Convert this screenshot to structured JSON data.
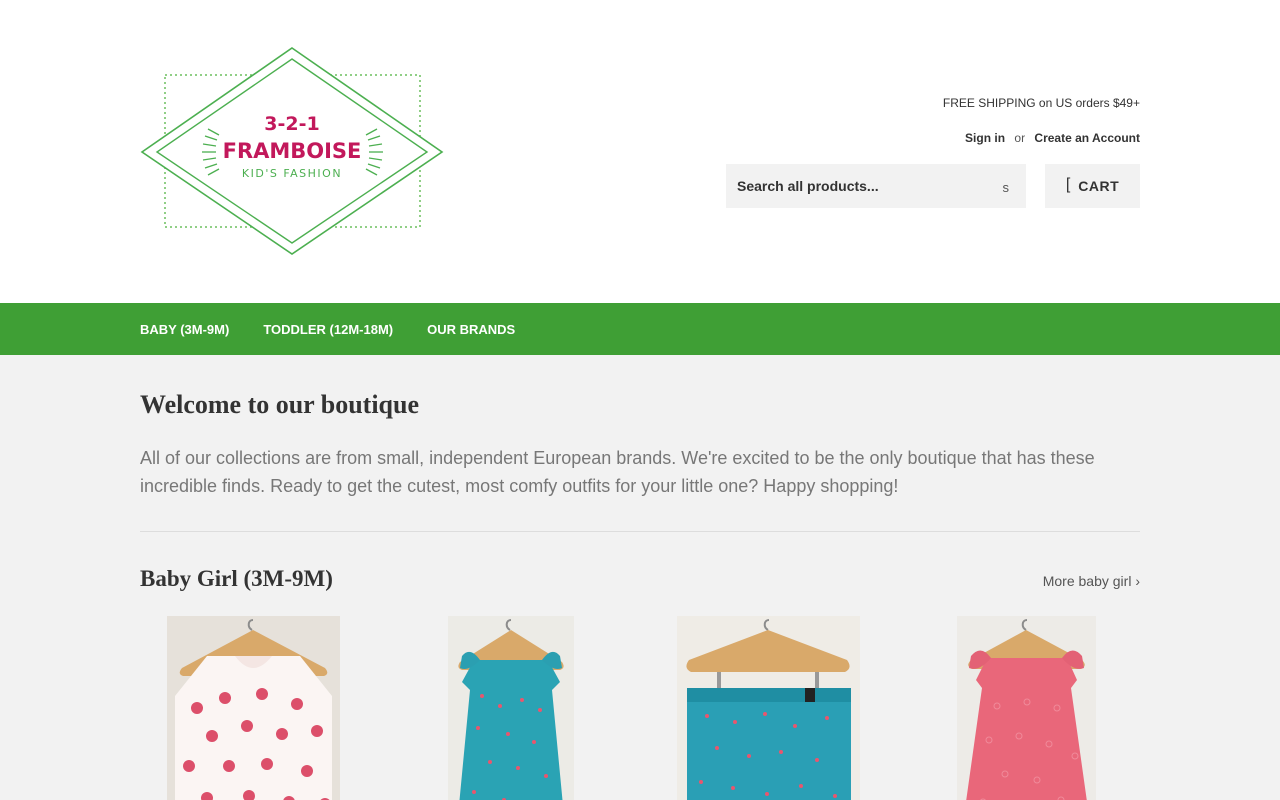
{
  "logo": {
    "line1": "3-2-1",
    "line2": "FRAMBOISE",
    "line3": "KID'S FASHION"
  },
  "header": {
    "shipping": "FREE SHIPPING on US orders $49+",
    "sign_in": "Sign in",
    "or": "or",
    "create_account": "Create an Account",
    "search_placeholder": "Search all products...",
    "search_button": "s",
    "cart_icon": "[",
    "cart_label": "CART"
  },
  "nav": {
    "items": [
      {
        "label": "BABY (3M-9M)"
      },
      {
        "label": "TODDLER (12M-18M)"
      },
      {
        "label": "OUR BRANDS"
      }
    ]
  },
  "welcome": {
    "title": "Welcome to our boutique",
    "text": "All of our collections are from small, independent European brands. We're excited to be the only boutique that has these incredible finds. Ready to get the cutest, most comfy outfits for your little one? Happy shopping!"
  },
  "section": {
    "title": "Baby Girl (3M-9M)",
    "more_link": "More baby girl ›"
  },
  "colors": {
    "nav_green": "#3f9f35",
    "logo_green": "#4caf50",
    "logo_magenta": "#c2185b"
  }
}
